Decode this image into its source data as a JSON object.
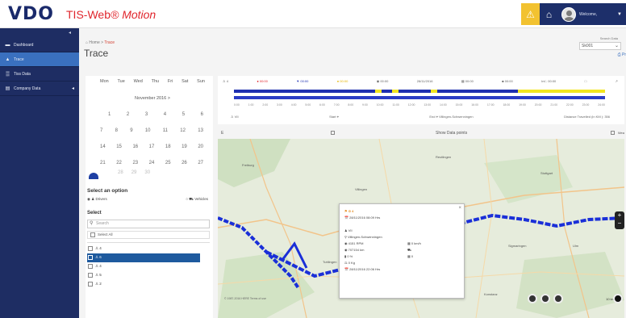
{
  "header": {
    "logo": "VDO",
    "app_name": "TIS-Web",
    "app_suffix": "® Motion",
    "user_name": "Welcome,",
    "warn_icon": "warning-icon",
    "home_icon": "home-icon"
  },
  "sidebar": {
    "toggle": "◂",
    "items": [
      {
        "label": "Dashboard",
        "icon": "▬"
      },
      {
        "label": "Trace",
        "icon": "▲"
      },
      {
        "label": "Tiss Data",
        "icon": "▒"
      },
      {
        "label": "Company Data",
        "icon": "▤",
        "caret": "◂"
      }
    ]
  },
  "breadcrumb": {
    "home": "⌂ Home",
    "sep": ">",
    "current": "Trace"
  },
  "page_title": "Trace",
  "search": {
    "label": "Search Data",
    "value": "Sk001"
  },
  "top_link": "⎙ Pr",
  "calendar": {
    "weekdays": [
      "Mon",
      "Tue",
      "Wed",
      "Thu",
      "Fri",
      "Sat",
      "Sun"
    ],
    "month": "November 2016",
    "next": ">",
    "weeks": [
      [
        "1",
        "2",
        "3",
        "4",
        "5",
        "6"
      ],
      [
        "7",
        "8",
        "9",
        "10",
        "11",
        "12",
        "13"
      ],
      [
        "14",
        "15",
        "16",
        "17",
        "18",
        "19",
        "20"
      ],
      [
        "21",
        "22",
        "23",
        "24",
        "25",
        "26",
        "27"
      ],
      [
        "28",
        "29",
        "30"
      ]
    ]
  },
  "options": {
    "title": "Select an option",
    "drivers": "Drivers",
    "vehicles": "Vehicles",
    "select_title": "Select",
    "search_placeholder": "Search",
    "select_all": "Select All"
  },
  "driver_list": [
    {
      "name": "♙ 4",
      "selected": false
    },
    {
      "name": "♙ 6",
      "selected": true
    },
    {
      "name": "♙ 4",
      "selected": false
    },
    {
      "name": "♙ 5",
      "selected": false
    },
    {
      "name": "♙ 2",
      "selected": false
    }
  ],
  "timeline": {
    "top": [
      "♙ 4",
      "● 00:00",
      "▼ 00:00",
      "● 00:00",
      "◉ 00:00",
      "28/11/2016",
      "▦ 00:00",
      "■ 00:00",
      "Int∴ 00:00",
      "□",
      "↗"
    ],
    "ticks": [
      "0:00",
      "1:00",
      "2:00",
      "3:00",
      "4:00",
      "5:00",
      "6:00",
      "7:00",
      "8:00",
      "9:00",
      "10:00",
      "11:00",
      "12:00",
      "13:00",
      "14:00",
      "15:00",
      "16:00",
      "17:00",
      "18:00",
      "19:00",
      "20:00",
      "21:00",
      "22:00",
      "23:00",
      "24:00"
    ],
    "bottom": [
      "♙ VII",
      "Start ⌖",
      "End ⌖ Villingen-Schwenningen",
      "Distance Travelled (in KM ): 356"
    ]
  },
  "map": {
    "left_label": "E",
    "show_points": "Show Data points",
    "right_label": "Wea",
    "copyright": "© 1987-2016 HERE Terms of use",
    "scale": "10 km",
    "zoom_in": "+",
    "zoom_out": "−",
    "places": [
      "Freiburg",
      "Villingen",
      "Reutlingen",
      "Stuttgart",
      "Ulm",
      "Tuttlingen",
      "Konstanz",
      "Sigmaringen"
    ],
    "ctrl_icons": [
      "layers-icon",
      "locate-icon",
      "screen-icon",
      "refresh-icon"
    ]
  },
  "popup": {
    "title_icons": "⚑ ⊙ 4",
    "date": "28/11/2016 08:09 Hrs",
    "driver": "VII",
    "location": "Villingen-Schwenningen",
    "rpm": "4151 RPM",
    "speed": "0 km/h",
    "odo": "707154 km",
    "fuel": "0 %",
    "mid": "0",
    "weight": "0 Kg",
    "date2": "28/11/2016 22:06 Hrs"
  }
}
